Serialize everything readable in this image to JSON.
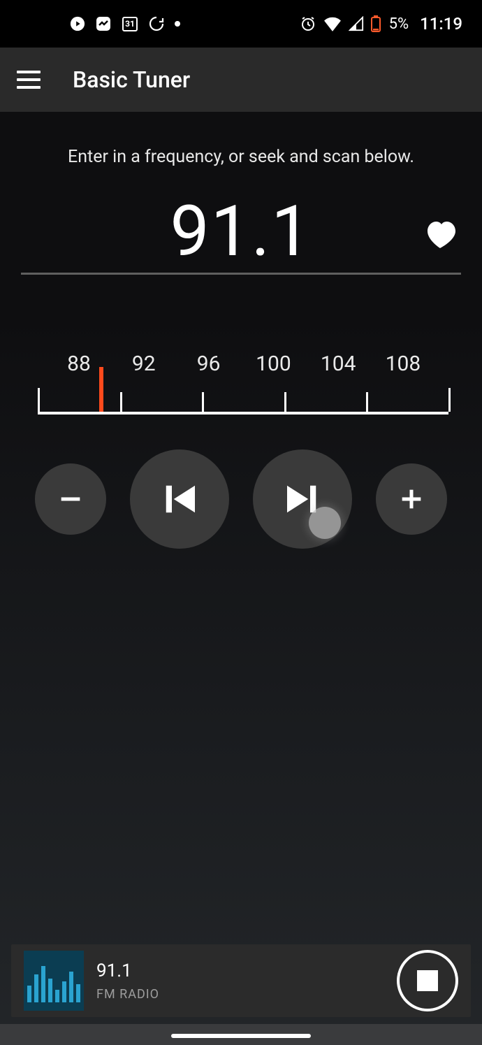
{
  "status": {
    "calendar_day": "31",
    "battery_percent": "5%",
    "time": "11:19"
  },
  "appbar": {
    "title": "Basic Tuner"
  },
  "main": {
    "hint": "Enter in a frequency, or seek and scan below.",
    "frequency": "91.1"
  },
  "dial": {
    "labels": [
      "88",
      "92",
      "96",
      "100",
      "104",
      "108"
    ],
    "min": 88,
    "max": 108,
    "needle_value": 91.1
  },
  "now_playing": {
    "title": "91.1",
    "subtitle": "FM RADIO"
  }
}
